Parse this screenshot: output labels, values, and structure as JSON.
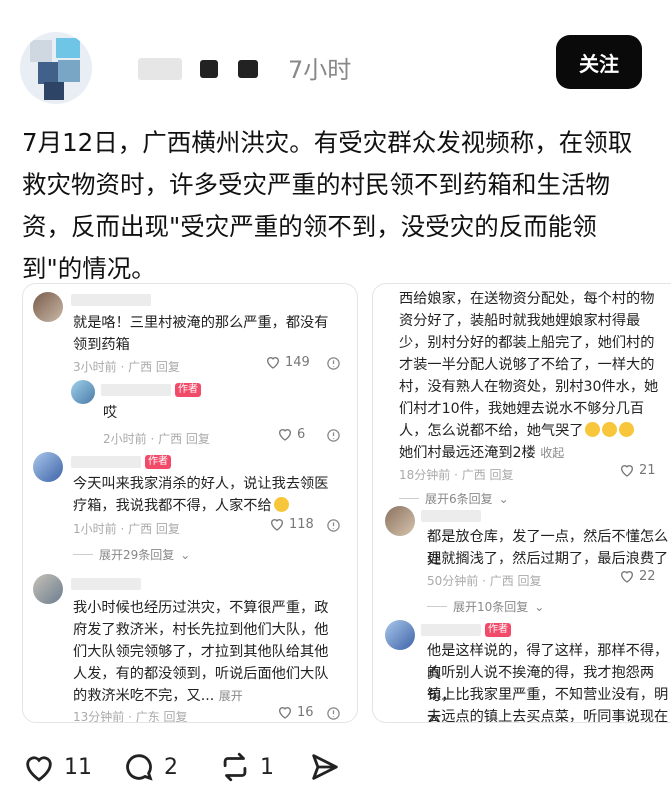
{
  "post": {
    "time_ago": "7小时",
    "follow_label": "关注",
    "text": "7月12日，广西横州洪灾。有受灾群众发视频称，在领取救灾物资时，许多受灾严重的村民领不到药箱和生活物资，反而出现\"受灾严重的领不到，没受灾的反而能领到\"的情况。"
  },
  "shot1": {
    "comments": [
      {
        "text_line1": "就是咯！三里村被淹的那么严重，都没有",
        "text_line2": "领到药箱",
        "meta": "3小时前 · 广西    回复",
        "likes": "149"
      },
      {
        "tag": "作者",
        "text": "哎",
        "meta": "2小时前 · 广西    回复",
        "likes": "6"
      },
      {
        "tag": "作者",
        "text_line1": "今天叫来我家消杀的好人，说让我去领医",
        "text_line2": "疗箱，我说我都不得，人家不给",
        "meta": "1小时前 · 广西    回复",
        "likes": "118",
        "expand": "展开29条回复"
      },
      {
        "text_line1": "我小时候也经历过洪灾，不算很严重，政",
        "text_line2": "府发了救济米，村长先拉到他们大队，他",
        "text_line3": "们大队领完领够了，才拉到其他队给其他",
        "text_line4": "人发，有的都没领到，听说后面他们大队",
        "text_line5": "的救济米吃不完，又...",
        "text_more": "展开",
        "meta": "13分钟前 · 广东    回复",
        "likes": "16"
      }
    ]
  },
  "shot2": {
    "top_lines": [
      "西给娘家，在送物资分配处，每个村的物",
      "资分好了，装船时就我她娌娘家村得最",
      "少，别村分好的都装上船完了，她们村的",
      "才装一半分配人说够了不给了，一样大的",
      "村，没有熟人在物资处，别村30件水，她",
      "们村才10件，我她娌去说水不够分几百",
      "人，怎么说都不给，她气哭了"
    ],
    "top_last_line": "她们村最远还淹到2楼",
    "top_collapse": "收起",
    "top_meta": "18分钟前 · 广西    回复",
    "top_likes": "21",
    "top_expand": "展开6条回复",
    "c2_line1": "都是放仓库，发了一点，然后不懂怎么处",
    "c2_line2": "理就搁浅了，然后过期了，最后浪费了",
    "c2_meta": "50分钟前 · 广西    回复",
    "c2_likes": "22",
    "c2_expand": "展开10条回复",
    "c3_tag": "作者",
    "c3_lines": [
      "他是这样说的，得了这样，那样不得，真",
      "的听别人说不挨淹的得，我才抱怨两句，",
      "镇上比我家里严重，不知营业没有，明天",
      "去远点的镇上去买点菜，听同事说现在菜"
    ]
  },
  "actions": {
    "likes": "11",
    "comments": "2",
    "reposts": "1"
  }
}
